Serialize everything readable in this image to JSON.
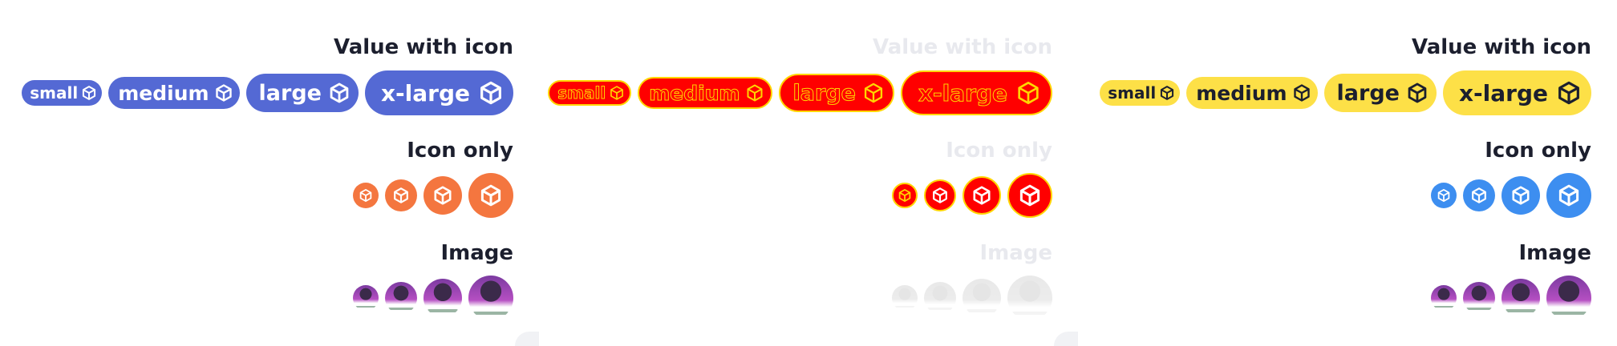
{
  "panels": [
    {
      "theme": "blue-orange",
      "colors": {
        "badge": "#5469d4",
        "icon_only": "#f4763f"
      },
      "value_with_icon_title": "Value with icon",
      "icon_only_title": "Icon only",
      "image_title": "Image",
      "badges": [
        "small",
        "medium",
        "large",
        "x-large"
      ]
    },
    {
      "theme": "faded-highlighted",
      "colors": {
        "badge": "#ff0000",
        "outline": "#ffd600"
      },
      "value_with_icon_title": "Value with icon",
      "icon_only_title": "Icon only",
      "image_title": "Image",
      "badges": [
        "small",
        "medium",
        "large",
        "x-large"
      ]
    },
    {
      "theme": "yellow-blue",
      "colors": {
        "badge": "#fde047",
        "icon_only": "#3d8ef0"
      },
      "value_with_icon_title": "Value with icon",
      "icon_only_title": "Icon only",
      "image_title": "Image",
      "badges": [
        "small",
        "medium",
        "large",
        "x-large"
      ]
    }
  ],
  "icon": "cube-icon"
}
